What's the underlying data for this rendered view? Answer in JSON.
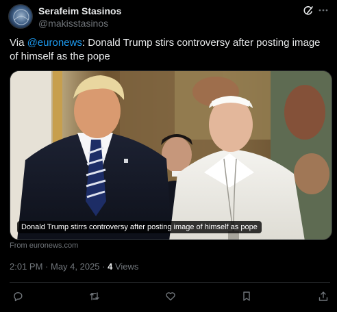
{
  "author": {
    "display_name": "Serafeim Stasinos",
    "handle": "@makisstasinos"
  },
  "post": {
    "prefix": "Via ",
    "mention": "@euronews",
    "body": ": Donald Trump stirs controversy after posting image of himself as the pope"
  },
  "media": {
    "caption": "Donald Trump stirrs controversy after posting image of himself as pope",
    "source": "From euronews.com"
  },
  "meta": {
    "time": "2:01 PM",
    "separator": " · ",
    "date": "May 4, 2025",
    "separator2": " · ",
    "views_count": "4",
    "views_label": " Views"
  },
  "icons": {
    "grok": "grok-icon",
    "more": "more-icon",
    "reply": "reply-icon",
    "repost": "repost-icon",
    "like": "like-icon",
    "bookmark": "bookmark-icon",
    "share": "share-icon"
  },
  "colors": {
    "background": "#000000",
    "text": "#e7e9ea",
    "secondary": "#71767b",
    "accent": "#1d9bf0",
    "border": "#2f3336"
  }
}
